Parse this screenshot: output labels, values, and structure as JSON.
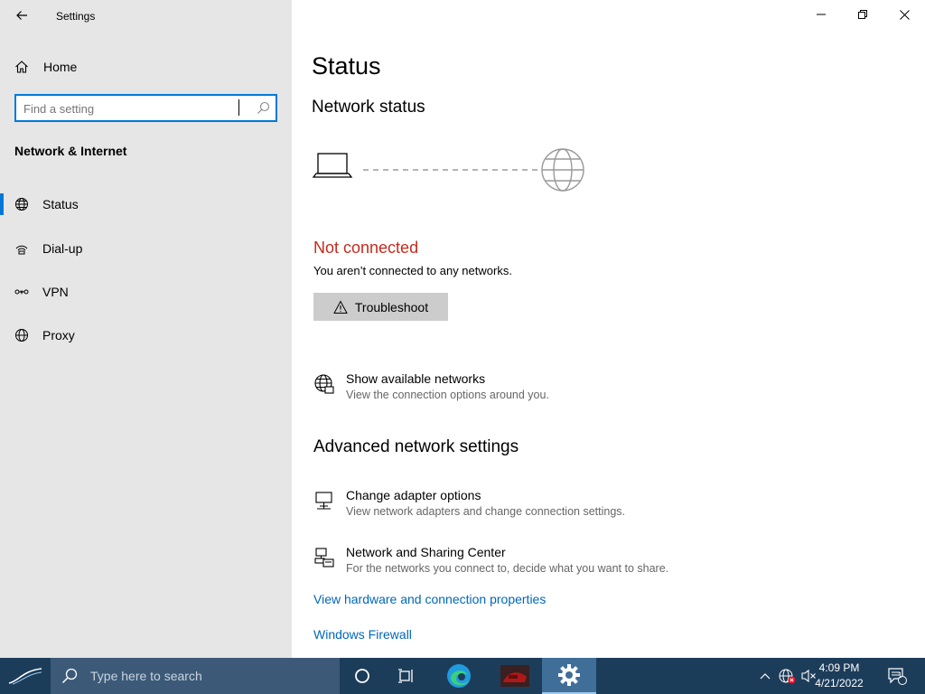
{
  "app": {
    "title": "Settings"
  },
  "sidebar": {
    "home_label": "Home",
    "search": {
      "placeholder": "Find a setting"
    },
    "section_title": "Network & Internet",
    "items": [
      {
        "label": "Status",
        "icon": "globe-network-icon",
        "active": true
      },
      {
        "label": "Dial-up",
        "icon": "dial-up-icon",
        "active": false
      },
      {
        "label": "VPN",
        "icon": "vpn-icon",
        "active": false
      },
      {
        "label": "Proxy",
        "icon": "globe-icon",
        "active": false
      }
    ]
  },
  "main": {
    "title": "Status",
    "network_status_heading": "Network status",
    "connection_status": "Not connected",
    "connection_desc": "You aren’t connected to any networks.",
    "troubleshoot_label": "Troubleshoot",
    "show_networks": {
      "title": "Show available networks",
      "desc": "View the connection options around you."
    },
    "advanced_heading": "Advanced network settings",
    "change_adapter": {
      "title": "Change adapter options",
      "desc": "View network adapters and change connection settings."
    },
    "sharing_center": {
      "title": "Network and Sharing Center",
      "desc": "For the networks you connect to, decide what you want to share."
    },
    "hardware_link": "View hardware and connection properties",
    "firewall_link": "Windows Firewall"
  },
  "taskbar": {
    "search_placeholder": "Type here to search",
    "time": "4:09 PM",
    "date": "4/21/2022",
    "notification_count": "1"
  },
  "colors": {
    "accent": "#0078d7",
    "error": "#c42b1c",
    "link": "#0067b8",
    "sidebar_bg": "#e6e6e6",
    "taskbar_bg": "#1c3d5a"
  }
}
